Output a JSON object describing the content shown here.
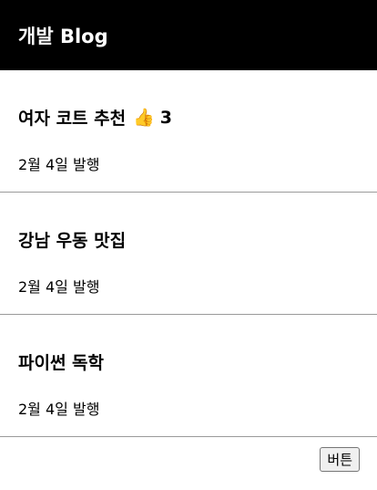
{
  "header": {
    "title": "개발 Blog"
  },
  "posts": [
    {
      "title": "여자 코트 추천",
      "date": "2월 4일 발행",
      "like_icon": "👍",
      "likes": "3"
    },
    {
      "title": "강남 우동 맛집",
      "date": "2월 4일 발행"
    },
    {
      "title": "파이썬 독학",
      "date": "2월 4일 발행"
    }
  ],
  "footer": {
    "button_label": "버튼"
  }
}
